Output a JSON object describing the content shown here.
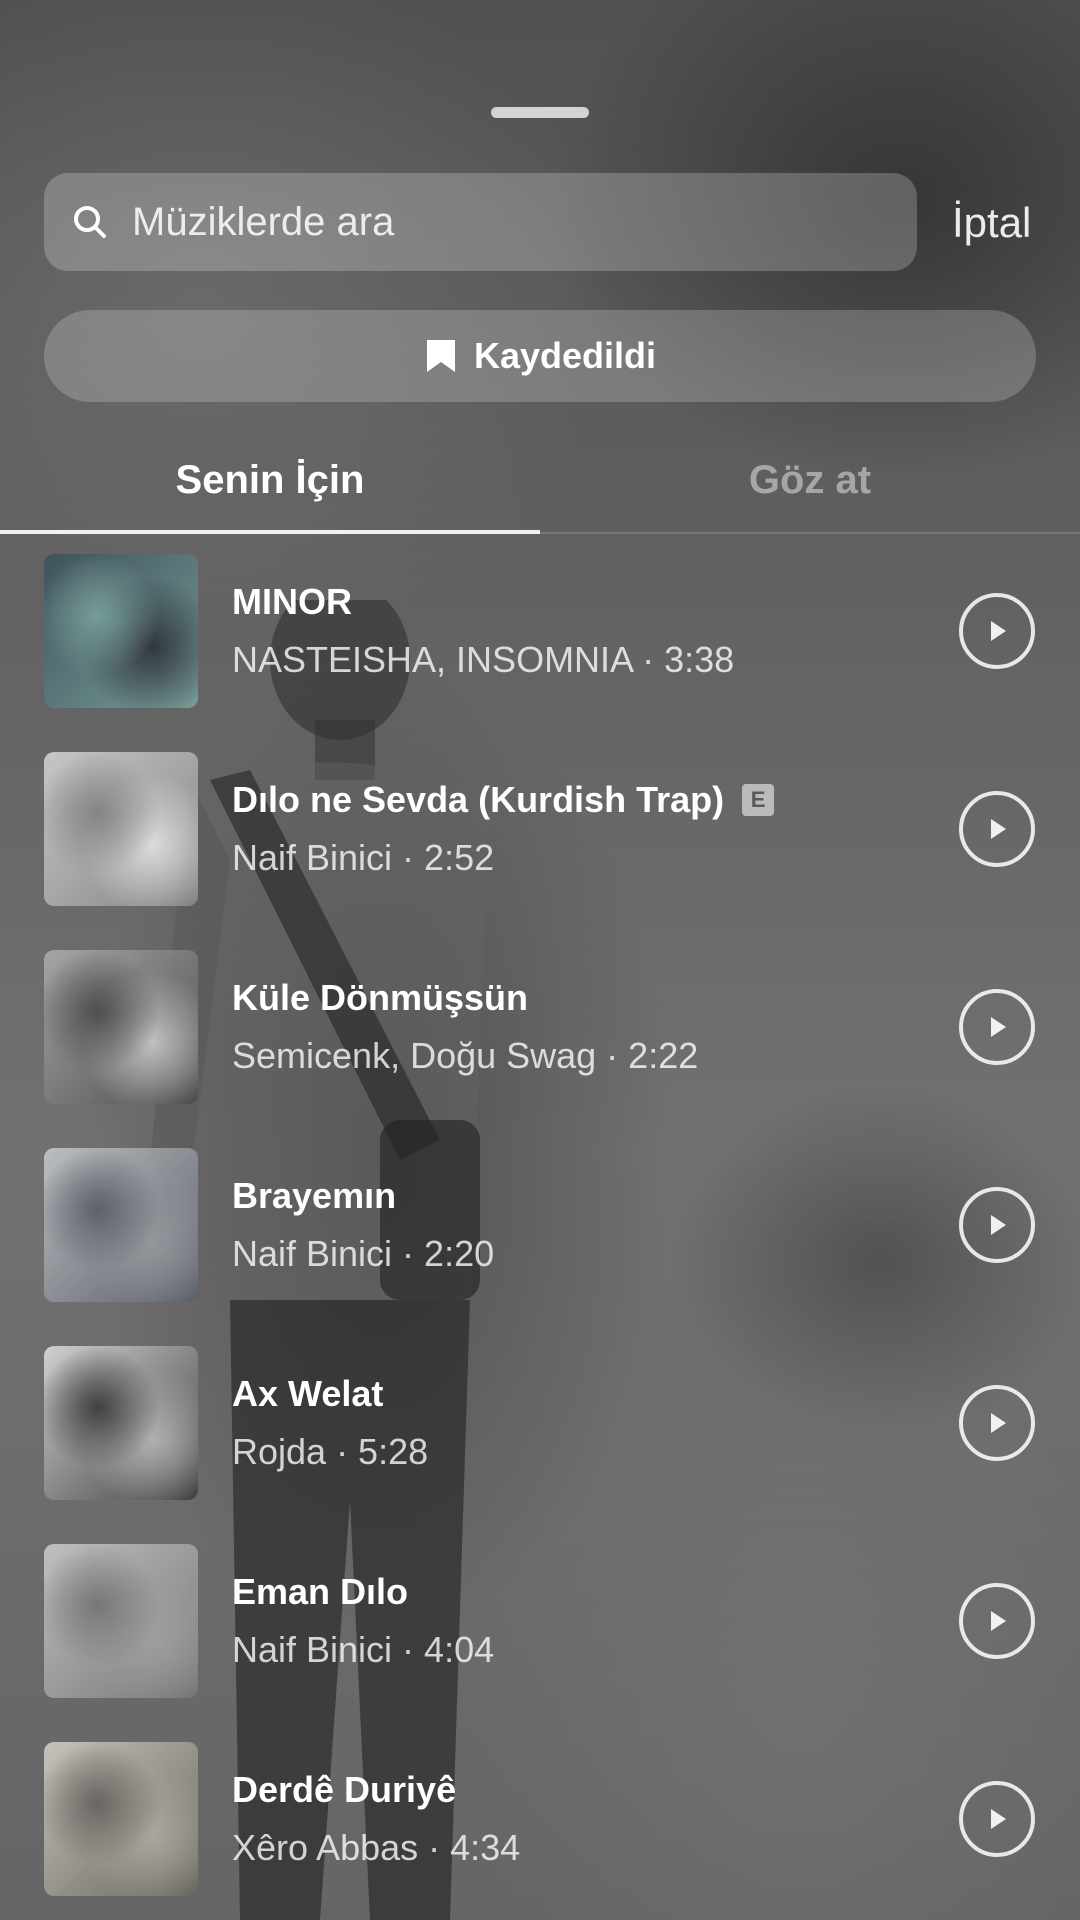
{
  "search": {
    "placeholder": "Müziklerde ara",
    "cancel_label": "İptal",
    "icon": "search-icon"
  },
  "saved_button": {
    "label": "Kaydedildi",
    "icon": "bookmark-icon"
  },
  "tabs": [
    {
      "label": "Senin İçin",
      "active": true
    },
    {
      "label": "Göz at",
      "active": false
    }
  ],
  "tracks": [
    {
      "title": "MINOR",
      "explicit": false,
      "subtitle": "NASTEISHA, INSOMNIA · 3:38",
      "cover_colors": [
        "#3a4f5c",
        "#7aa7a0",
        "#2a2f3a"
      ]
    },
    {
      "title": "Dılo ne Sevda (Kurdish Trap)",
      "explicit": true,
      "explicit_label": "E",
      "subtitle": "Naif Binici · 2:52",
      "cover_colors": [
        "#d8d8d8",
        "#8a8a8a",
        "#f0f0f0"
      ]
    },
    {
      "title": "Küle Dönmüşsün",
      "explicit": false,
      "subtitle": "Semicenk, Doğu Swag · 2:22",
      "cover_colors": [
        "#b0b0b0",
        "#4a4a4a",
        "#d0d0d0"
      ]
    },
    {
      "title": "Brayemın",
      "explicit": false,
      "subtitle": "Naif Binici · 2:20",
      "cover_colors": [
        "#c7cdd2",
        "#5a6068",
        "#9aa0a6"
      ]
    },
    {
      "title": "Ax Welat",
      "explicit": false,
      "subtitle": "Rojda · 5:28",
      "cover_colors": [
        "#e2e2e2",
        "#3a3a3a",
        "#bdbdbd"
      ]
    },
    {
      "title": "Eman Dılo",
      "explicit": false,
      "subtitle": "Naif Binici · 4:04",
      "cover_colors": [
        "#cfcfcf",
        "#7a7a7a",
        "#a8a8a8"
      ]
    },
    {
      "title": "Derdê Duriyê",
      "explicit": false,
      "subtitle": "Xêro Abbas · 4:34",
      "cover_colors": [
        "#d8d4cc",
        "#6a6660",
        "#b8b2a8"
      ]
    }
  ],
  "play_icon": "play-icon"
}
